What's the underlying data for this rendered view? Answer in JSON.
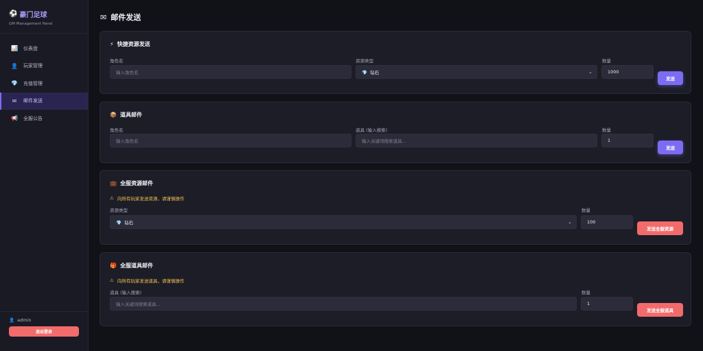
{
  "sidebar": {
    "brand_icon": "⚽",
    "brand_title": "豪门足球",
    "brand_sub": "GM Management Panel",
    "items": [
      {
        "icon": "📊",
        "label": "仪表盘"
      },
      {
        "icon": "👤",
        "label": "玩家管理"
      },
      {
        "icon": "💎",
        "label": "充值管理"
      },
      {
        "icon": "✉",
        "label": "邮件发送"
      },
      {
        "icon": "📢",
        "label": "全服公告"
      }
    ],
    "active_index": 3,
    "user_icon": "👤",
    "username": "admin",
    "logout_label": "退出登录"
  },
  "page": {
    "icon": "✉",
    "title": "邮件发送"
  },
  "quick": {
    "icon": "⚡",
    "title": "快捷资源发送",
    "role_label": "角色名",
    "role_placeholder": "输入角色名",
    "type_label": "资源类型",
    "type_icon": "💎",
    "type_value": "钻石",
    "qty_label": "数量",
    "qty_value": "1000",
    "send_label": "发送"
  },
  "item_mail": {
    "icon": "📦",
    "title": "道具邮件",
    "role_label": "角色名",
    "role_placeholder": "输入角色名",
    "item_label": "道具 (输入搜索)",
    "item_placeholder": "输入关键词搜索道具...",
    "qty_label": "数量",
    "qty_value": "1",
    "send_label": "发送"
  },
  "server_res": {
    "icon": "💼",
    "title": "全服资源邮件",
    "warn_icon": "⚠",
    "warning": "向所有玩家发送资源，请谨慎操作",
    "type_label": "资源类型",
    "type_icon": "💎",
    "type_value": "钻石",
    "qty_label": "数量",
    "qty_value": "100",
    "send_label": "发送全服资源"
  },
  "server_item": {
    "icon": "🎁",
    "title": "全服道具邮件",
    "warn_icon": "⚠",
    "warning": "向所有玩家发送道具，请谨慎操作",
    "item_label": "道具 (输入搜索)",
    "item_placeholder": "输入关键词搜索道具...",
    "qty_label": "数量",
    "qty_value": "1",
    "send_label": "发送全服道具"
  },
  "colors": {
    "accent": "#7c6cf2",
    "danger": "#f26b6b",
    "warning": "#f2c14e"
  }
}
